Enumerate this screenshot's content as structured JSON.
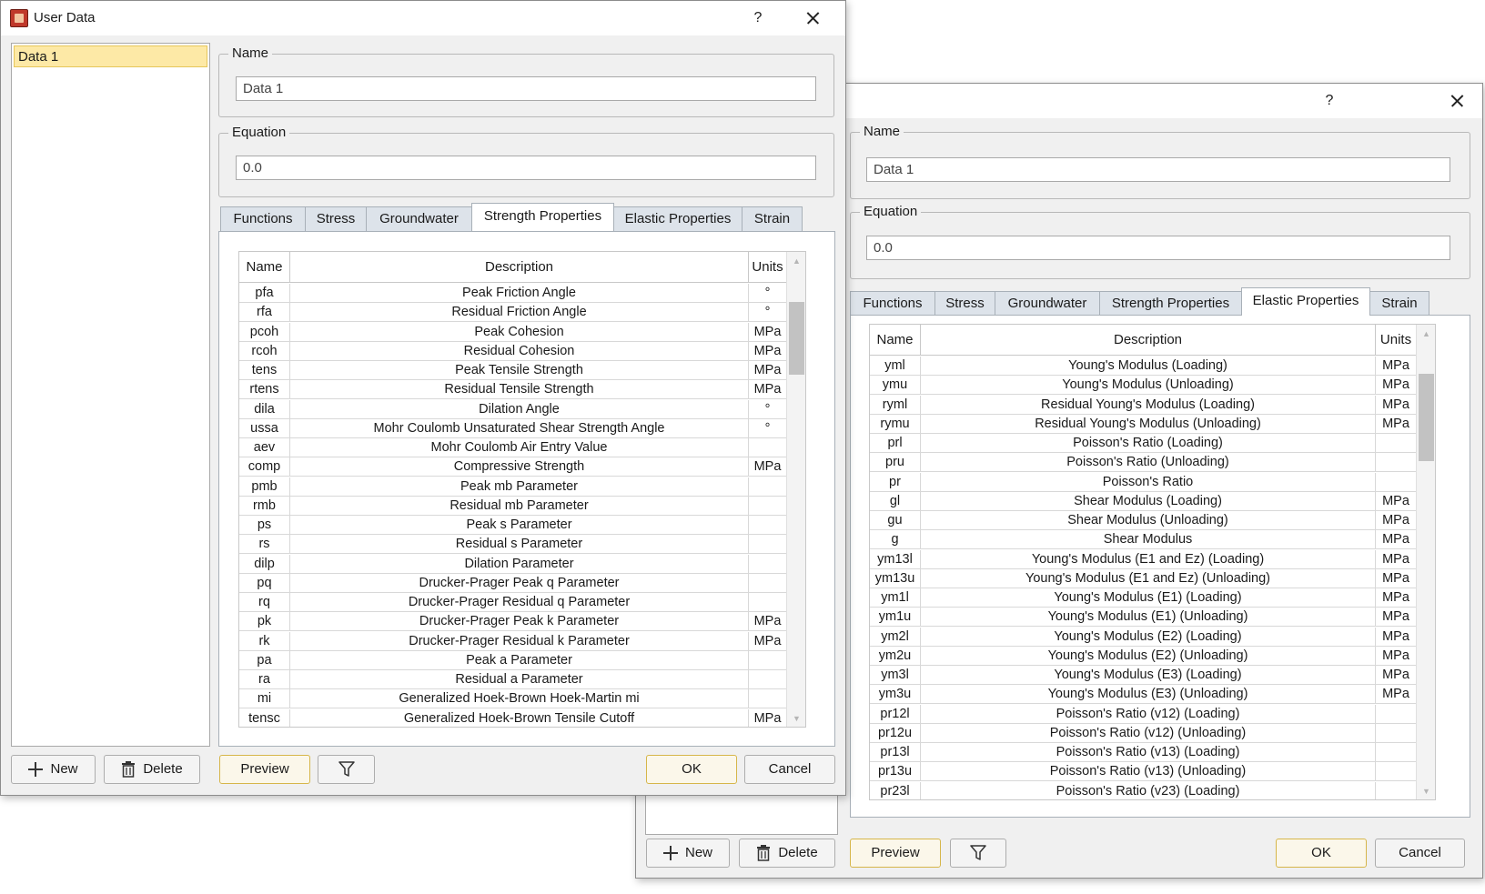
{
  "dialog_front": {
    "title": "User Data",
    "help_label": "?",
    "list_items": [
      "Data 1"
    ],
    "name_group_label": "Name",
    "name_value": "Data 1",
    "equation_group_label": "Equation",
    "equation_value": "0.0",
    "tabs": [
      "Functions",
      "Stress",
      "Groundwater",
      "Strength Properties",
      "Elastic Properties",
      "Strain"
    ],
    "active_tab": "Strength Properties",
    "table_headers": [
      "Name",
      "Description",
      "Units"
    ],
    "rows": [
      {
        "name": "pfa",
        "description": "Peak Friction Angle",
        "units": "°"
      },
      {
        "name": "rfa",
        "description": "Residual Friction Angle",
        "units": "°"
      },
      {
        "name": "pcoh",
        "description": "Peak Cohesion",
        "units": "MPa"
      },
      {
        "name": "rcoh",
        "description": "Residual Cohesion",
        "units": "MPa"
      },
      {
        "name": "tens",
        "description": "Peak Tensile Strength",
        "units": "MPa"
      },
      {
        "name": "rtens",
        "description": "Residual Tensile Strength",
        "units": "MPa"
      },
      {
        "name": "dila",
        "description": "Dilation Angle",
        "units": "°"
      },
      {
        "name": "ussa",
        "description": "Mohr Coulomb Unsaturated Shear Strength Angle",
        "units": "°"
      },
      {
        "name": "aev",
        "description": "Mohr Coulomb Air Entry Value",
        "units": ""
      },
      {
        "name": "comp",
        "description": "Compressive Strength",
        "units": "MPa"
      },
      {
        "name": "pmb",
        "description": "Peak mb Parameter",
        "units": ""
      },
      {
        "name": "rmb",
        "description": "Residual mb Parameter",
        "units": ""
      },
      {
        "name": "ps",
        "description": "Peak s Parameter",
        "units": ""
      },
      {
        "name": "rs",
        "description": "Residual s Parameter",
        "units": ""
      },
      {
        "name": "dilp",
        "description": "Dilation Parameter",
        "units": ""
      },
      {
        "name": "pq",
        "description": "Drucker-Prager Peak q Parameter",
        "units": ""
      },
      {
        "name": "rq",
        "description": "Drucker-Prager Residual q Parameter",
        "units": ""
      },
      {
        "name": "pk",
        "description": "Drucker-Prager Peak k Parameter",
        "units": "MPa"
      },
      {
        "name": "rk",
        "description": "Drucker-Prager Residual k Parameter",
        "units": "MPa"
      },
      {
        "name": "pa",
        "description": "Peak a Parameter",
        "units": ""
      },
      {
        "name": "ra",
        "description": "Residual a Parameter",
        "units": ""
      },
      {
        "name": "mi",
        "description": "Generalized Hoek-Brown Hoek-Martin mi",
        "units": ""
      },
      {
        "name": "tensc",
        "description": "Generalized Hoek-Brown Tensile Cutoff",
        "units": "MPa"
      }
    ],
    "buttons": {
      "new": "New",
      "delete": "Delete",
      "preview": "Preview",
      "ok": "OK",
      "cancel": "Cancel"
    }
  },
  "dialog_back": {
    "help_label": "?",
    "name_group_label": "Name",
    "name_value": "Data 1",
    "equation_group_label": "Equation",
    "equation_value": "0.0",
    "tabs": [
      "Functions",
      "Stress",
      "Groundwater",
      "Strength Properties",
      "Elastic Properties",
      "Strain"
    ],
    "active_tab": "Elastic Properties",
    "table_headers": [
      "Name",
      "Description",
      "Units"
    ],
    "rows": [
      {
        "name": "yml",
        "description": "Young's Modulus (Loading)",
        "units": "MPa"
      },
      {
        "name": "ymu",
        "description": "Young's Modulus (Unloading)",
        "units": "MPa"
      },
      {
        "name": "ryml",
        "description": "Residual Young's Modulus (Loading)",
        "units": "MPa"
      },
      {
        "name": "rymu",
        "description": "Residual Young's Modulus (Unloading)",
        "units": "MPa"
      },
      {
        "name": "prl",
        "description": "Poisson's Ratio (Loading)",
        "units": ""
      },
      {
        "name": "pru",
        "description": "Poisson's Ratio (Unloading)",
        "units": ""
      },
      {
        "name": "pr",
        "description": "Poisson's Ratio",
        "units": ""
      },
      {
        "name": "gl",
        "description": "Shear Modulus (Loading)",
        "units": "MPa"
      },
      {
        "name": "gu",
        "description": "Shear Modulus (Unloading)",
        "units": "MPa"
      },
      {
        "name": "g",
        "description": "Shear Modulus",
        "units": "MPa"
      },
      {
        "name": "ym13l",
        "description": "Young's Modulus (E1 and Ez) (Loading)",
        "units": "MPa"
      },
      {
        "name": "ym13u",
        "description": "Young's Modulus (E1 and Ez) (Unloading)",
        "units": "MPa"
      },
      {
        "name": "ym1l",
        "description": "Young's Modulus (E1) (Loading)",
        "units": "MPa"
      },
      {
        "name": "ym1u",
        "description": "Young's Modulus (E1) (Unloading)",
        "units": "MPa"
      },
      {
        "name": "ym2l",
        "description": "Young's Modulus (E2) (Loading)",
        "units": "MPa"
      },
      {
        "name": "ym2u",
        "description": "Young's Modulus (E2) (Unloading)",
        "units": "MPa"
      },
      {
        "name": "ym3l",
        "description": "Young's Modulus (E3) (Loading)",
        "units": "MPa"
      },
      {
        "name": "ym3u",
        "description": "Young's Modulus (E3) (Unloading)",
        "units": "MPa"
      },
      {
        "name": "pr12l",
        "description": "Poisson's Ratio (v12) (Loading)",
        "units": ""
      },
      {
        "name": "pr12u",
        "description": "Poisson's Ratio (v12) (Unloading)",
        "units": ""
      },
      {
        "name": "pr13l",
        "description": "Poisson's Ratio (v13) (Loading)",
        "units": ""
      },
      {
        "name": "pr13u",
        "description": "Poisson's Ratio (v13) (Unloading)",
        "units": ""
      },
      {
        "name": "pr23l",
        "description": "Poisson's Ratio (v23) (Loading)",
        "units": ""
      }
    ],
    "buttons": {
      "new": "New",
      "delete": "Delete",
      "preview": "Preview",
      "ok": "OK",
      "cancel": "Cancel"
    }
  }
}
